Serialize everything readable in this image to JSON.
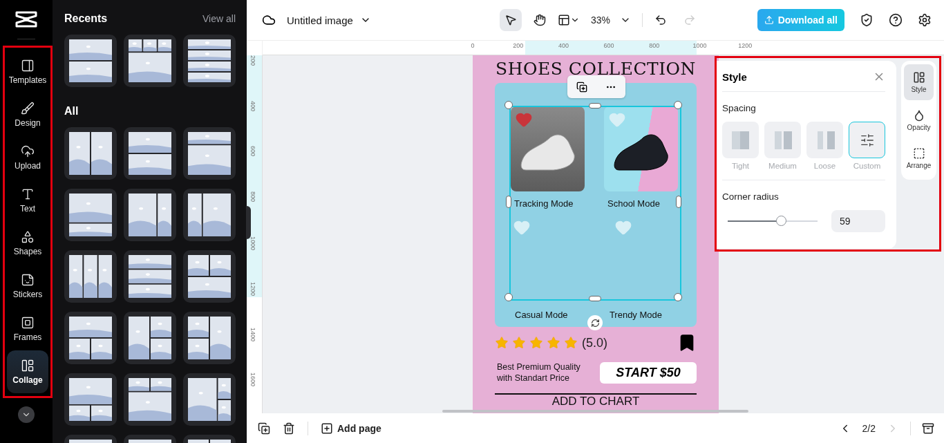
{
  "rail": {
    "items": [
      {
        "label": "Templates",
        "selected": false
      },
      {
        "label": "Design",
        "selected": false
      },
      {
        "label": "Upload",
        "selected": false
      },
      {
        "label": "Text",
        "selected": false
      },
      {
        "label": "Shapes",
        "selected": false
      },
      {
        "label": "Stickers",
        "selected": false
      },
      {
        "label": "Frames",
        "selected": false
      },
      {
        "label": "Collage",
        "selected": true
      }
    ]
  },
  "collage_panel": {
    "recents_title": "Recents",
    "view_all": "View all",
    "all_title": "All"
  },
  "toolbar": {
    "document_title": "Untitled image",
    "zoom": "33%",
    "download": "Download all"
  },
  "rulers": {
    "horizontal": [
      "0",
      "200",
      "400",
      "600",
      "800",
      "1000",
      "1200"
    ],
    "vertical": [
      "200",
      "400",
      "600",
      "800",
      "1000",
      "1200",
      "1400",
      "1600"
    ]
  },
  "design": {
    "title": "SHOES COLLECTION",
    "items": [
      {
        "label": "Tracking Mode",
        "liked": true
      },
      {
        "label": "School Mode",
        "liked": false
      },
      {
        "label": "Casual Mode",
        "liked": false
      },
      {
        "label": "Trendy Mode",
        "liked": false
      }
    ],
    "stars": 5,
    "rating": "(5.0)",
    "description": "Best Premium Quality\nwith Standart Price",
    "price": "START $50",
    "footer": "ADD TO CHART"
  },
  "style_panel": {
    "title": "Style",
    "spacing_label": "Spacing",
    "spacing_options": [
      {
        "label": "Tight",
        "selected": false
      },
      {
        "label": "Medium",
        "selected": false
      },
      {
        "label": "Loose",
        "selected": false
      },
      {
        "label": "Custom",
        "selected": true
      }
    ],
    "corner_label": "Corner radius",
    "corner": {
      "level": 0.59,
      "value": "59"
    }
  },
  "side_tabs": [
    {
      "label": "Style",
      "selected": true
    },
    {
      "label": "Opacity",
      "selected": false
    },
    {
      "label": "Arrange",
      "selected": false
    }
  ],
  "bottom_bar": {
    "add_page": "Add page",
    "page": "2/2"
  }
}
